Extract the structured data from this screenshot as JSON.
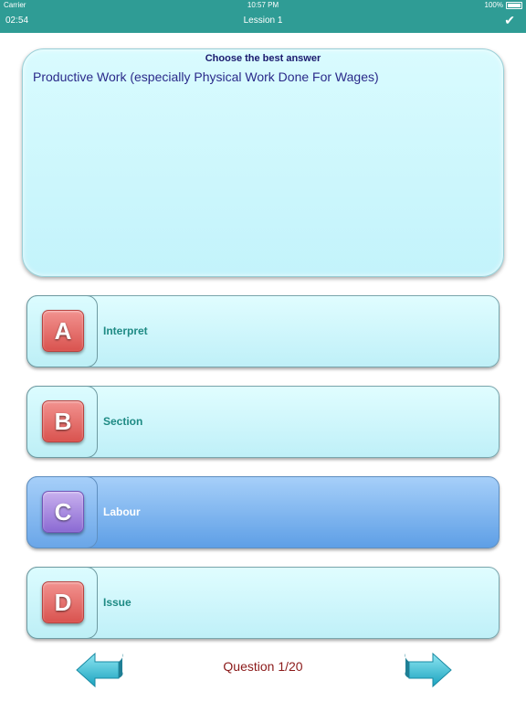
{
  "status_bar": {
    "carrier": "Carrier",
    "time": "10:57 PM",
    "battery": "100%"
  },
  "nav": {
    "timer": "02:54",
    "title": "Lession 1",
    "check_icon": "checkmark-icon"
  },
  "question": {
    "heading": "Choose the best answer",
    "text": "Productive Work (especially Physical Work Done For Wages)"
  },
  "options": [
    {
      "letter": "A",
      "label": "Interpret",
      "selected": false
    },
    {
      "letter": "B",
      "label": "Section",
      "selected": false
    },
    {
      "letter": "C",
      "label": "Labour",
      "selected": true
    },
    {
      "letter": "D",
      "label": "Issue",
      "selected": false
    }
  ],
  "footer": {
    "counter": "Question 1/20"
  },
  "colors": {
    "accent": "#2f9c95",
    "selected": "#5e9fe6",
    "badge": "#d9534f",
    "counter": "#8b1a1a"
  }
}
